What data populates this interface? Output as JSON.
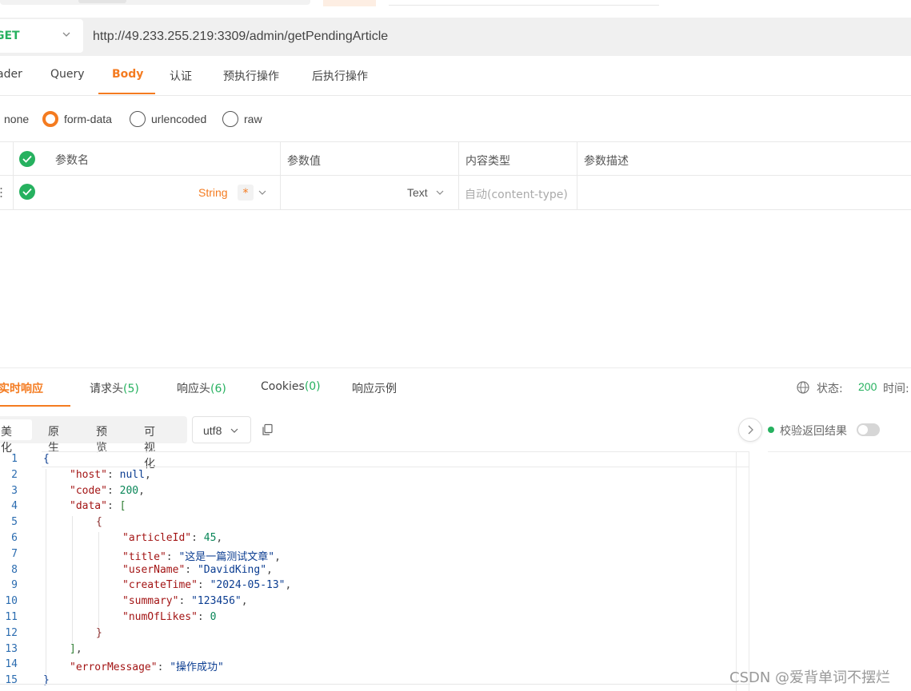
{
  "request": {
    "method": "GET",
    "url": "http://49.233.255.219:3309/admin/getPendingArticle",
    "tabs": [
      {
        "label": "ader"
      },
      {
        "label": "Query"
      },
      {
        "label": "Body"
      },
      {
        "label": "认证"
      },
      {
        "label": "预执行操作"
      },
      {
        "label": "后执行操作"
      }
    ],
    "active_tab": "Body",
    "body_types": [
      {
        "label": "none",
        "checked": false
      },
      {
        "label": "form-data",
        "checked": true
      },
      {
        "label": "urlencoded",
        "checked": false
      },
      {
        "label": "raw",
        "checked": false
      }
    ]
  },
  "params_table": {
    "headers": [
      "参数名",
      "参数值",
      "内容类型",
      "参数描述"
    ],
    "row": {
      "type": "String",
      "required_mark": "*",
      "value_type": "Text",
      "content_type_placeholder": "自动(content-type)"
    }
  },
  "response": {
    "tabs": [
      {
        "label": "实时响应",
        "count": ""
      },
      {
        "label": "请求头",
        "count": "(5)"
      },
      {
        "label": "响应头",
        "count": "(6)"
      },
      {
        "label": "Cookies",
        "count": "(0)"
      },
      {
        "label": "响应示例",
        "count": ""
      }
    ],
    "status_label": "状态:",
    "status_code": "200",
    "time_label": "时间:",
    "view_modes": [
      "美化",
      "原生",
      "预览",
      "可视化"
    ],
    "active_view": "美化",
    "encoding": "utf8",
    "validate_label": "校验返回结果",
    "validate_enabled": false,
    "line_numbers": [
      "1",
      "2",
      "3",
      "4",
      "5",
      "6",
      "7",
      "8",
      "9",
      "10",
      "11",
      "12",
      "13",
      "14",
      "15"
    ],
    "json_lines": [
      {
        "indent": 0,
        "tokens": [
          {
            "t": "{",
            "c": "br1"
          }
        ]
      },
      {
        "indent": 1,
        "tokens": [
          {
            "t": "\"host\"",
            "c": "k"
          },
          {
            "t": ": ",
            "c": "p"
          },
          {
            "t": "null",
            "c": "nl"
          },
          {
            "t": ",",
            "c": "p"
          }
        ]
      },
      {
        "indent": 1,
        "tokens": [
          {
            "t": "\"code\"",
            "c": "k"
          },
          {
            "t": ": ",
            "c": "p"
          },
          {
            "t": "200",
            "c": "n"
          },
          {
            "t": ",",
            "c": "p"
          }
        ]
      },
      {
        "indent": 1,
        "tokens": [
          {
            "t": "\"data\"",
            "c": "k"
          },
          {
            "t": ": ",
            "c": "p"
          },
          {
            "t": "[",
            "c": "br2"
          }
        ]
      },
      {
        "indent": 2,
        "tokens": [
          {
            "t": "{",
            "c": "br3"
          }
        ]
      },
      {
        "indent": 3,
        "tokens": [
          {
            "t": "\"articleId\"",
            "c": "k"
          },
          {
            "t": ": ",
            "c": "p"
          },
          {
            "t": "45",
            "c": "n"
          },
          {
            "t": ",",
            "c": "p"
          }
        ]
      },
      {
        "indent": 3,
        "tokens": [
          {
            "t": "\"title\"",
            "c": "k"
          },
          {
            "t": ": ",
            "c": "p"
          },
          {
            "t": "\"这是一篇测试文章\"",
            "c": "s"
          },
          {
            "t": ",",
            "c": "p"
          }
        ]
      },
      {
        "indent": 3,
        "tokens": [
          {
            "t": "\"userName\"",
            "c": "k"
          },
          {
            "t": ": ",
            "c": "p"
          },
          {
            "t": "\"DavidKing\"",
            "c": "s"
          },
          {
            "t": ",",
            "c": "p"
          }
        ]
      },
      {
        "indent": 3,
        "tokens": [
          {
            "t": "\"createTime\"",
            "c": "k"
          },
          {
            "t": ": ",
            "c": "p"
          },
          {
            "t": "\"2024-05-13\"",
            "c": "s"
          },
          {
            "t": ",",
            "c": "p"
          }
        ]
      },
      {
        "indent": 3,
        "tokens": [
          {
            "t": "\"summary\"",
            "c": "k"
          },
          {
            "t": ": ",
            "c": "p"
          },
          {
            "t": "\"123456\"",
            "c": "s"
          },
          {
            "t": ",",
            "c": "p"
          }
        ]
      },
      {
        "indent": 3,
        "tokens": [
          {
            "t": "\"numOfLikes\"",
            "c": "k"
          },
          {
            "t": ": ",
            "c": "p"
          },
          {
            "t": "0",
            "c": "n"
          }
        ]
      },
      {
        "indent": 2,
        "tokens": [
          {
            "t": "}",
            "c": "br3"
          }
        ]
      },
      {
        "indent": 1,
        "tokens": [
          {
            "t": "]",
            "c": "br2"
          },
          {
            "t": ",",
            "c": "p"
          }
        ]
      },
      {
        "indent": 1,
        "tokens": [
          {
            "t": "\"errorMessage\"",
            "c": "k"
          },
          {
            "t": ": ",
            "c": "p"
          },
          {
            "t": "\"操作成功\"",
            "c": "s"
          }
        ]
      },
      {
        "indent": 0,
        "tokens": [
          {
            "t": "}",
            "c": "br1"
          }
        ]
      }
    ]
  },
  "watermark": "CSDN @爱背单词不摆烂",
  "colors": {
    "accent": "#f47b20",
    "success": "#26b15f"
  },
  "icons": [
    "chevron-down-icon",
    "check-circle-icon",
    "globe-icon",
    "copy-icon",
    "chevron-right-icon",
    "drag-handle-icon"
  ]
}
